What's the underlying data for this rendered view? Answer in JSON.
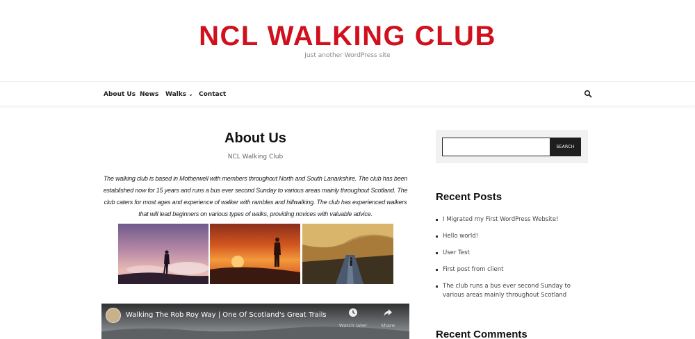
{
  "site": {
    "title": "NCL WALKING CLUB",
    "tagline": "Just another WordPress site",
    "accent_color": "#d0101d"
  },
  "nav": {
    "items": [
      "About Us",
      "News",
      "Walks",
      "Contact"
    ],
    "walks_chevron_icon": "chevron-down-icon",
    "search_icon": "search-icon"
  },
  "page": {
    "title": "About Us",
    "subtitle": "NCL Walking Club",
    "body": "The walking club is based in Motherwell with members throughout North and South Lanarkshire.  The club has been established now for 15 years and runs a bus ever second Sunday to various areas mainly throughout Scotland.  The club caters for most ages and experience of walker with rambles and hillwalking.  The club has experienced walkers that will lead beginners on various types of walks, providing novices with valuable advice."
  },
  "gallery": {
    "photos": [
      "hiker-at-dusk-photo",
      "hiker-at-sunset-photo",
      "walker-on-road-photo"
    ]
  },
  "video": {
    "title": "Walking The Rob Roy Way | One Of Scotland's Great Trails",
    "watch_later_label": "Watch later",
    "share_label": "Share"
  },
  "sidebar": {
    "search_placeholder": "",
    "search_button_label": "SEARCH",
    "recent_posts_heading": "Recent Posts",
    "recent_posts": [
      "I Migrated my First WordPress Website!",
      "Hello world!",
      "User Test",
      "First post from client",
      "The club runs a bus ever second Sunday to various areas mainly throughout Scotland"
    ],
    "recent_comments_heading": "Recent Comments"
  }
}
